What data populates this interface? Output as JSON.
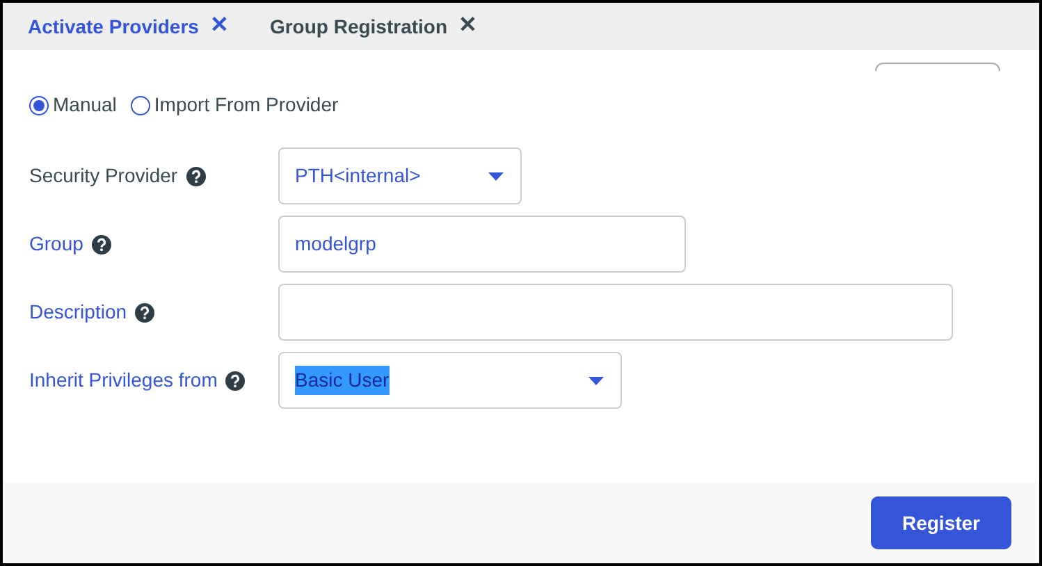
{
  "tabs": [
    {
      "label": "Activate Providers",
      "selected": true,
      "close": "✕"
    },
    {
      "label": "Group Registration",
      "selected": false,
      "close": "✕"
    }
  ],
  "mode": [
    {
      "label": "Manual",
      "selected": true
    },
    {
      "label": "Import From Provider",
      "selected": false
    }
  ],
  "fields": [
    {
      "label": "Security Provider",
      "accent": false,
      "kind": "select",
      "value": "PTH<internal>"
    },
    {
      "label": "Group",
      "accent": true,
      "kind": "text",
      "value": "modelgrp"
    },
    {
      "label": "Description",
      "accent": true,
      "kind": "text"
    },
    {
      "label": "Inherit Privileges from",
      "accent": true,
      "kind": "select",
      "value": "Basic User",
      "value_selected": true
    }
  ],
  "register_button": "Register"
}
